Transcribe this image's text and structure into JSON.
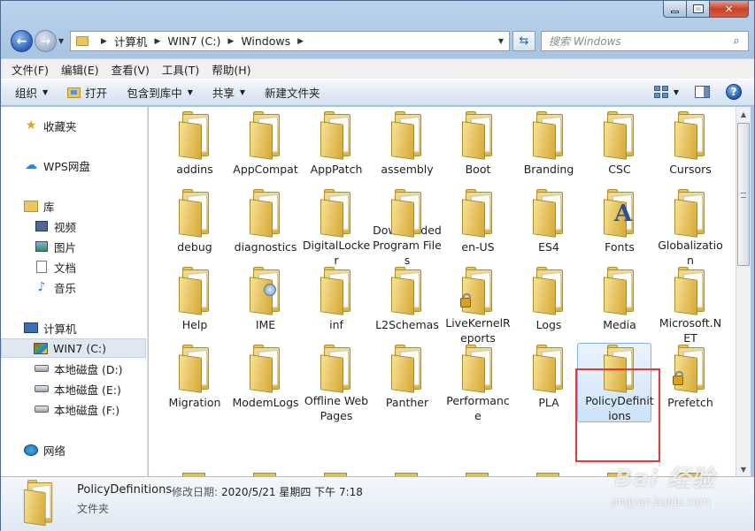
{
  "address": {
    "crumbs": [
      "计算机",
      "WIN7 (C:)",
      "Windows"
    ]
  },
  "search": {
    "placeholder": "搜索 Windows"
  },
  "menu": [
    "文件(F)",
    "编辑(E)",
    "查看(V)",
    "工具(T)",
    "帮助(H)"
  ],
  "toolbar": {
    "organize": "组织",
    "open": "打开",
    "include_library": "包含到库中",
    "share": "共享",
    "new_folder": "新建文件夹"
  },
  "nav": {
    "favorites": "收藏夹",
    "wps": "WPS网盘",
    "libraries": "库",
    "videos": "视频",
    "pictures": "图片",
    "documents": "文档",
    "music": "音乐",
    "computer": "计算机",
    "drive_c": "WIN7 (C:)",
    "drive_d": "本地磁盘 (D:)",
    "drive_e": "本地磁盘 (E:)",
    "drive_f": "本地磁盘 (F:)",
    "network": "网络"
  },
  "folders": [
    "addins",
    "AppCompat",
    "AppPatch",
    "assembly",
    "Boot",
    "Branding",
    "CSC",
    "Cursors",
    "debug",
    "diagnostics",
    "DigitalLocker",
    "Downloaded Program Files",
    "en-US",
    "ES4",
    "Fonts",
    "Globalization",
    "Help",
    "IME",
    "inf",
    "L2Schemas",
    "LiveKernelReports",
    "Logs",
    "Media",
    "Microsoft.NET",
    "Migration",
    "ModemLogs",
    "Offline Web Pages",
    "Panther",
    "Performance",
    "PLA",
    "PolicyDefinitions",
    "Prefetch"
  ],
  "details": {
    "name": "PolicyDefinitions",
    "modified_label": "修改日期:",
    "modified_value": "2020/5/21 星期四 下午 7:18",
    "type": "文件夹"
  },
  "watermark": {
    "brand": "Bai 经验",
    "url": "jingyan.baidu.com"
  },
  "colors": {
    "selection_outline": "#e53935",
    "accent": "#2a62b5"
  }
}
